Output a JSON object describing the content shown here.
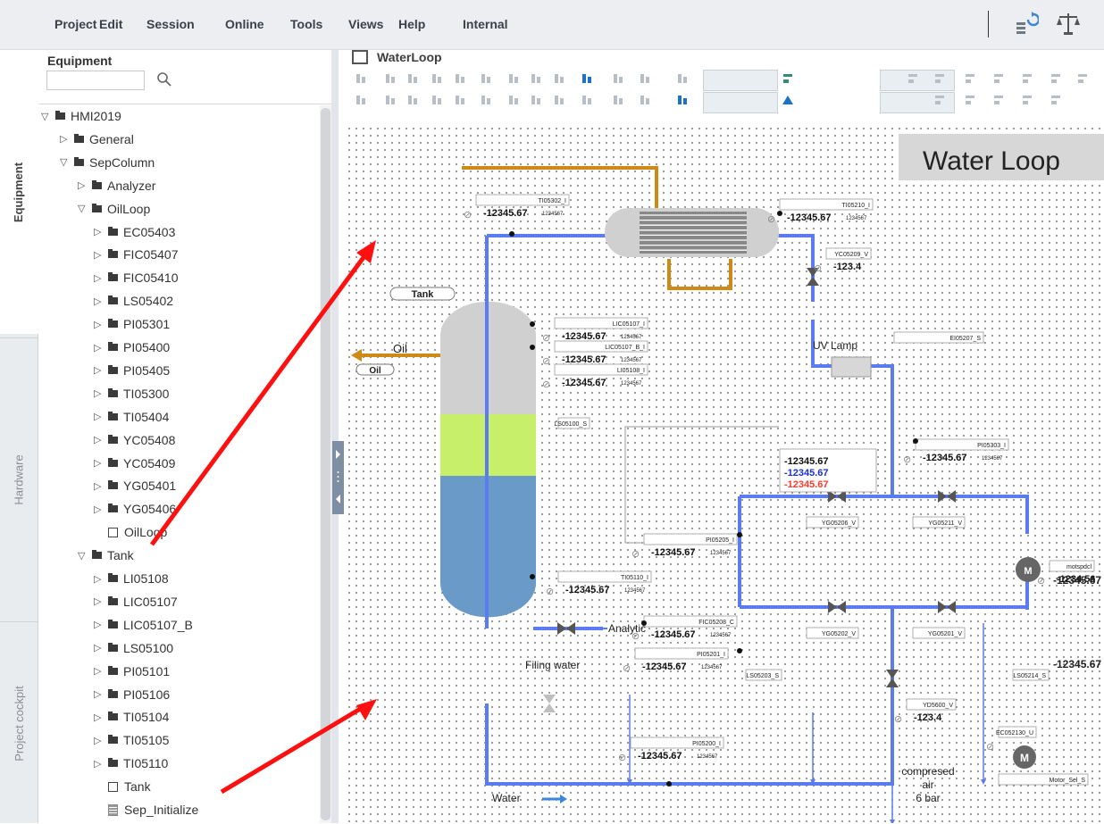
{
  "menu": [
    "Project",
    "Edit",
    "Session",
    "Online",
    "Tools",
    "Views",
    "Help",
    "Internal"
  ],
  "side_tabs": {
    "equipment": "Equipment",
    "hardware": "Hardware",
    "cockpit": "Project cockpit"
  },
  "equipment_panel": {
    "title": "Equipment",
    "search_value": "",
    "search_placeholder": ""
  },
  "tree": [
    {
      "label": "HMI2019",
      "level": 0,
      "type": "folder",
      "expanded": true
    },
    {
      "label": "General",
      "level": 1,
      "type": "folder",
      "expanded": false
    },
    {
      "label": "SepColumn",
      "level": 1,
      "type": "folder",
      "expanded": true
    },
    {
      "label": "Analyzer",
      "level": 2,
      "type": "folder",
      "expanded": false
    },
    {
      "label": "OilLoop",
      "level": 2,
      "type": "folder",
      "expanded": true
    },
    {
      "label": "EC05403",
      "level": 3,
      "type": "folder",
      "expanded": false
    },
    {
      "label": "FIC05407",
      "level": 3,
      "type": "folder",
      "expanded": false
    },
    {
      "label": "FIC05410",
      "level": 3,
      "type": "folder",
      "expanded": false
    },
    {
      "label": "LS05402",
      "level": 3,
      "type": "folder",
      "expanded": false
    },
    {
      "label": "PI05301",
      "level": 3,
      "type": "folder",
      "expanded": false
    },
    {
      "label": "PI05400",
      "level": 3,
      "type": "folder",
      "expanded": false
    },
    {
      "label": "PI05405",
      "level": 3,
      "type": "folder",
      "expanded": false
    },
    {
      "label": "TI05300",
      "level": 3,
      "type": "folder",
      "expanded": false
    },
    {
      "label": "TI05404",
      "level": 3,
      "type": "folder",
      "expanded": false
    },
    {
      "label": "YC05408",
      "level": 3,
      "type": "folder",
      "expanded": false
    },
    {
      "label": "YC05409",
      "level": 3,
      "type": "folder",
      "expanded": false
    },
    {
      "label": "YG05401",
      "level": 3,
      "type": "folder",
      "expanded": false
    },
    {
      "label": "YG05406",
      "level": 3,
      "type": "folder",
      "expanded": false
    },
    {
      "label": "OilLoop",
      "level": 3,
      "type": "faceplate"
    },
    {
      "label": "Tank",
      "level": 2,
      "type": "folder",
      "expanded": true
    },
    {
      "label": "LI05108",
      "level": 3,
      "type": "folder",
      "expanded": false
    },
    {
      "label": "LIC05107",
      "level": 3,
      "type": "folder",
      "expanded": false
    },
    {
      "label": "LIC05107_B",
      "level": 3,
      "type": "folder",
      "expanded": false
    },
    {
      "label": "LS05100",
      "level": 3,
      "type": "folder",
      "expanded": false
    },
    {
      "label": "PI05101",
      "level": 3,
      "type": "folder",
      "expanded": false
    },
    {
      "label": "PI05106",
      "level": 3,
      "type": "folder",
      "expanded": false
    },
    {
      "label": "TI05104",
      "level": 3,
      "type": "folder",
      "expanded": false
    },
    {
      "label": "TI05105",
      "level": 3,
      "type": "folder",
      "expanded": false
    },
    {
      "label": "TI05110",
      "level": 3,
      "type": "folder",
      "expanded": false
    },
    {
      "label": "Tank",
      "level": 3,
      "type": "faceplate"
    },
    {
      "label": "Sep_Initialize",
      "level": 3,
      "type": "script"
    }
  ],
  "editor": {
    "tab_title": "WaterLoop"
  },
  "diagram": {
    "title": "Water Loop",
    "labels": {
      "tank": "Tank",
      "oil_button": "Oil",
      "oil": "Oil",
      "uv_lamp": "UV Lamp",
      "analytic": "Analytic",
      "filling_water": "Filing water",
      "water": "Water",
      "compressed_air": "compresed\nair\n6 bar"
    },
    "tags": [
      {
        "id": "TI05302_I",
        "value": "-12345.67",
        "unit": "1234567"
      },
      {
        "id": "TI05210_I",
        "value": "-12345.67",
        "unit": "1234567"
      },
      {
        "id": "YC05209_V",
        "value": "-123.4"
      },
      {
        "id": "LS05100_S"
      },
      {
        "id": "LIC05107_I",
        "value": "-12345.67",
        "unit": "1234567"
      },
      {
        "id": "LIC05107_B_I",
        "value": "-12345.67",
        "unit": "1234567"
      },
      {
        "id": "LI05108_I",
        "value": "-12345.67",
        "unit": "1234567"
      },
      {
        "id": "EI05207_S"
      },
      {
        "id": "PI05303_I",
        "value": "-12345.67",
        "unit": "1234567"
      },
      {
        "id": "FIC05208_C",
        "value": "-12345.67",
        "value2": "-12345.67",
        "value3": "-12345.67",
        "unit": "1234567"
      },
      {
        "id": "YG05206_V"
      },
      {
        "id": "YG05211_V"
      },
      {
        "id": "PI05205_I",
        "value": "-12345.67",
        "unit": "1234567"
      },
      {
        "id": "motspdcl",
        "value": "-1234.56"
      },
      {
        "id": "TI05110_I",
        "value": "-12345.67",
        "unit": "1234567"
      },
      {
        "id": "YG05202_V"
      },
      {
        "id": "YG05201_V"
      },
      {
        "id": "PI05201_I",
        "value": "-12345.67",
        "unit": "1234567"
      },
      {
        "id": "LS05203_S"
      },
      {
        "id": "LS05214_S"
      },
      {
        "id": "YD5600_V",
        "value": "-123.4"
      },
      {
        "id": "PI05200_I",
        "value": "-12345.67",
        "unit": "1234567"
      },
      {
        "id": "EC052130_U"
      },
      {
        "id": "Motor_Sel_S"
      },
      {
        "id": "P_right_1",
        "value": "-12345.67"
      },
      {
        "id": "P_right_2",
        "value": "-12345.67"
      }
    ]
  },
  "colors": {
    "water": "#5b7cf0",
    "oil": "#cf8a16",
    "vessel": "#d0d0d0",
    "oil_layer": "#c8ef6a",
    "water_layer": "#6a9ac8",
    "arrow": "#ff1010",
    "red_value": "#ff3b2b",
    "blue_value": "#1b30e0"
  }
}
